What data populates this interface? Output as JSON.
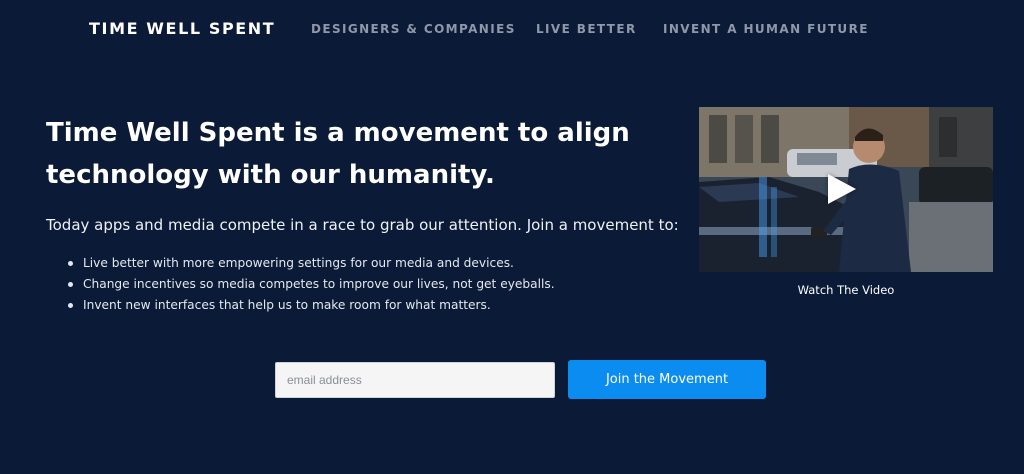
{
  "nav": {
    "brand": "TIME WELL SPENT",
    "links": [
      "DESIGNERS & COMPANIES",
      "LIVE BETTER",
      "INVENT A HUMAN FUTURE"
    ]
  },
  "hero": {
    "headline_line1": "Time Well Spent is a movement to align",
    "headline_line2": "technology with our humanity.",
    "intro": "Today apps and media compete in a race to grab our attention. Join a movement to:",
    "bullets": [
      "Live better with more empowering settings for our media and devices.",
      "Change incentives so media competes to improve our lives, not get eyeballs.",
      "Invent new interfaces that help us to make room for what matters."
    ]
  },
  "video": {
    "caption": "Watch The Video",
    "icon": "play-icon"
  },
  "signup": {
    "email_placeholder": "email address",
    "email_value": "",
    "button_label": "Join the Movement"
  },
  "colors": {
    "background": "#0b1a36",
    "nav_link": "#8e98a9",
    "button": "#0a8cf0"
  }
}
